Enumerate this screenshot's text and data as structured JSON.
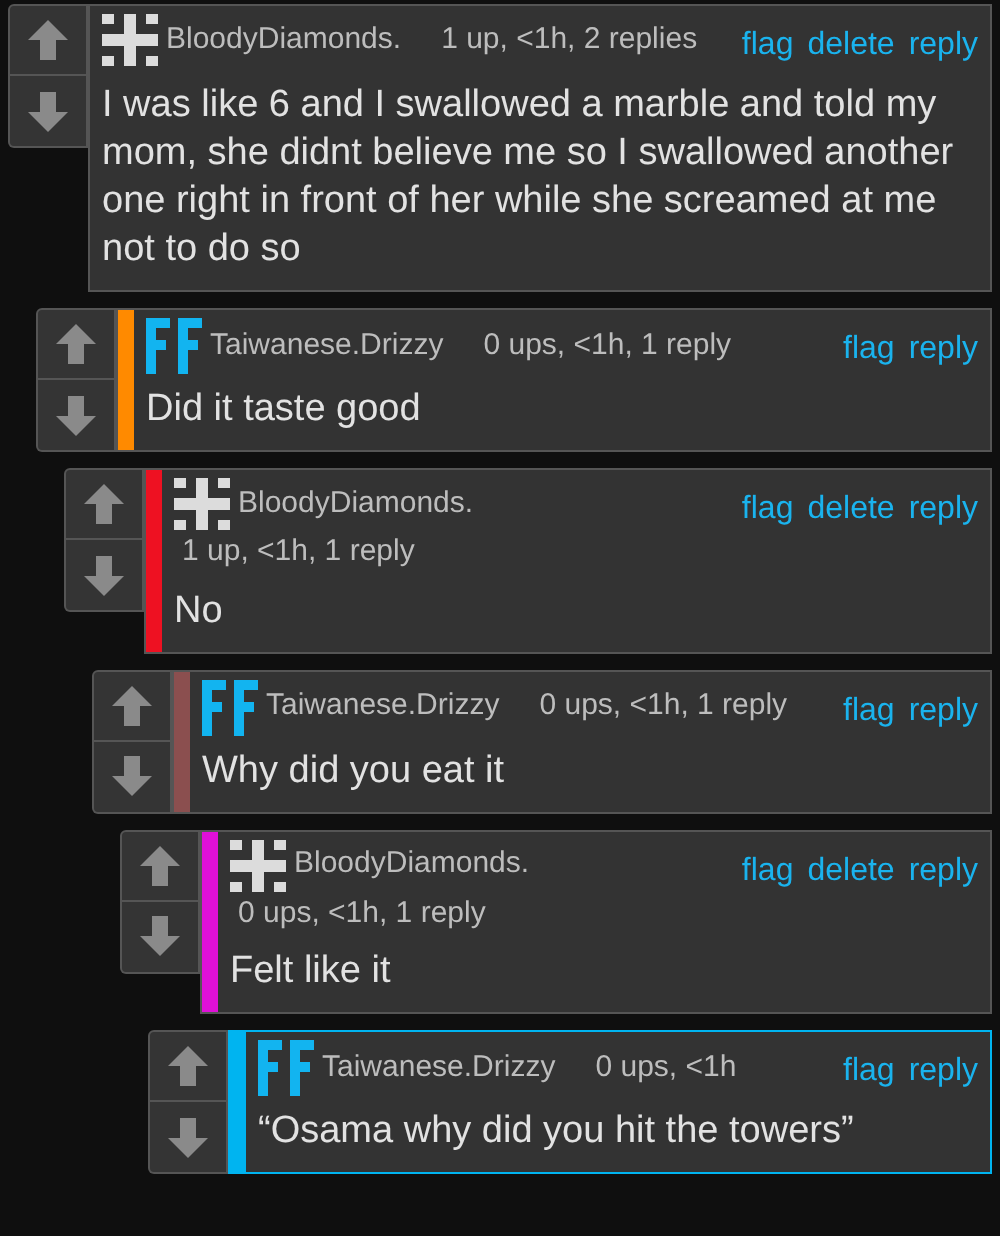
{
  "comments": [
    {
      "kind": "cross",
      "username": "BloodyDiamonds.",
      "meta": "1 up, <1h, 2 replies",
      "links": [
        "flag",
        "delete",
        "reply"
      ],
      "text": "I was like 6 and I swallowed a marble and told my mom, she didnt believe me so I swallowed another one right in front of her while she screamed at me not to do so",
      "selected": false,
      "children": [
        {
          "kind": "ff",
          "username": "Taiwanese.Drizzy",
          "meta": "0 ups, <1h, 1 reply",
          "links": [
            "flag",
            "reply"
          ],
          "text": "Did it taste good",
          "color": "#ff8a00",
          "selected": false,
          "children": [
            {
              "kind": "cross",
              "username": "BloodyDiamonds.",
              "meta": "1 up, <1h, 1 reply",
              "links": [
                "flag",
                "delete",
                "reply"
              ],
              "text": "No",
              "color": "#ee1122",
              "selected": false,
              "children": [
                {
                  "kind": "ff",
                  "username": "Taiwanese.Drizzy",
                  "meta": "0 ups, <1h, 1 reply",
                  "links": [
                    "flag",
                    "reply"
                  ],
                  "text": "Why did you eat it",
                  "color": "#8b4f4f",
                  "selected": false,
                  "children": [
                    {
                      "kind": "cross",
                      "username": "BloodyDiamonds.",
                      "meta": "0 ups, <1h, 1 reply",
                      "links": [
                        "flag",
                        "delete",
                        "reply"
                      ],
                      "text": "Felt like it",
                      "color": "#e010d8",
                      "selected": false,
                      "children": [
                        {
                          "kind": "ff",
                          "username": "Taiwanese.Drizzy",
                          "meta": "0 ups, <1h",
                          "links": [
                            "flag",
                            "reply"
                          ],
                          "text": "“Osama why did you hit the towers”",
                          "color": "#00b4f0",
                          "selected": true
                        }
                      ]
                    }
                  ]
                }
              ]
            }
          ]
        }
      ]
    }
  ]
}
